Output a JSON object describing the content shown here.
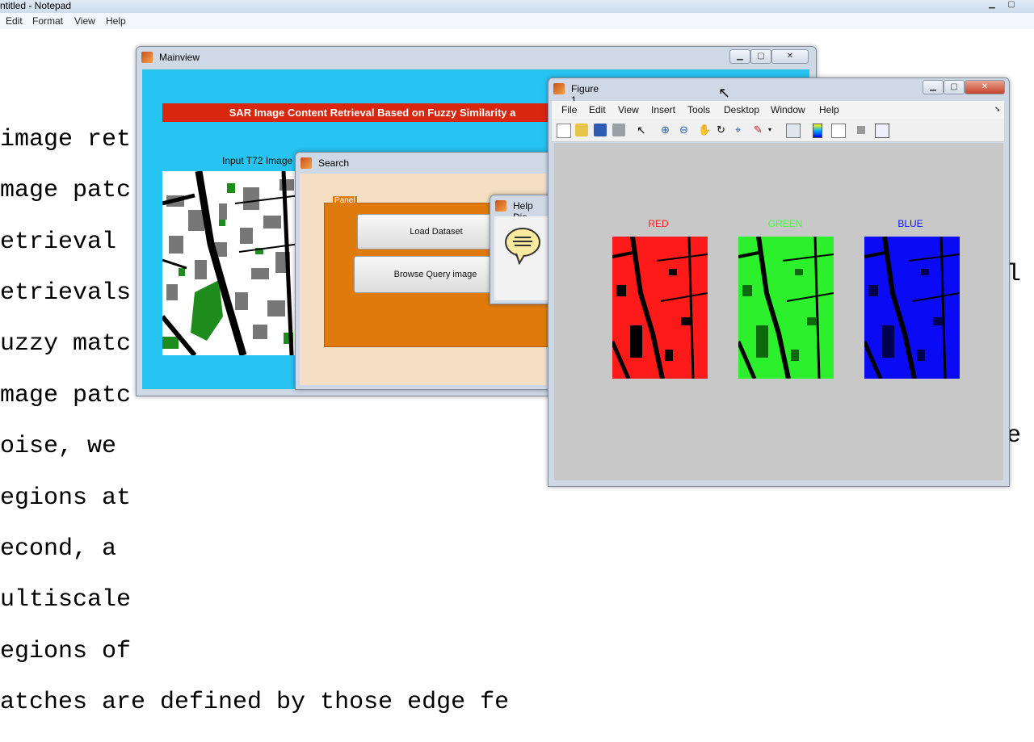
{
  "notepad": {
    "title": "ntitled - Notepad",
    "menu": [
      "Edit",
      "Format",
      "View",
      "Help"
    ],
    "lines": [
      "image ret",
      "mage patc",
      "etrieval ",
      "etrievals",
      "uzzy matc",
      "mage patc",
      "oise, we ",
      "egions at",
      "econd, a ",
      "ultiscale",
      "egions of",
      "atches are defined by those edge fe"
    ],
    "right_chars": [
      "l",
      "e"
    ]
  },
  "mainview": {
    "title": "Mainview",
    "banner": "SAR Image Content Retrieval Based on Fuzzy Similarity a",
    "input_label": "Input T72 Image"
  },
  "search": {
    "title": "Search",
    "panel_label": "Panel",
    "load_label": "Load Dataset",
    "browse_label": "Browse Query image"
  },
  "help_dialog": {
    "title": "Help Dia"
  },
  "figure": {
    "title": "Figure 1",
    "menu": [
      "File",
      "Edit",
      "View",
      "Insert",
      "Tools",
      "Desktop",
      "Window",
      "Help"
    ],
    "channels": [
      {
        "label": "RED",
        "color": "#ff2020"
      },
      {
        "label": "GREEN",
        "color": "#3cff3c"
      },
      {
        "label": "BLUE",
        "color": "#1010ff"
      }
    ]
  },
  "colors": {
    "mainview_bg": "#27c3f1",
    "banner_bg": "#d8260f",
    "panel_bg": "#e07a0c",
    "search_bg": "#f4dfc2",
    "figure_bg": "#c8c8c8"
  }
}
